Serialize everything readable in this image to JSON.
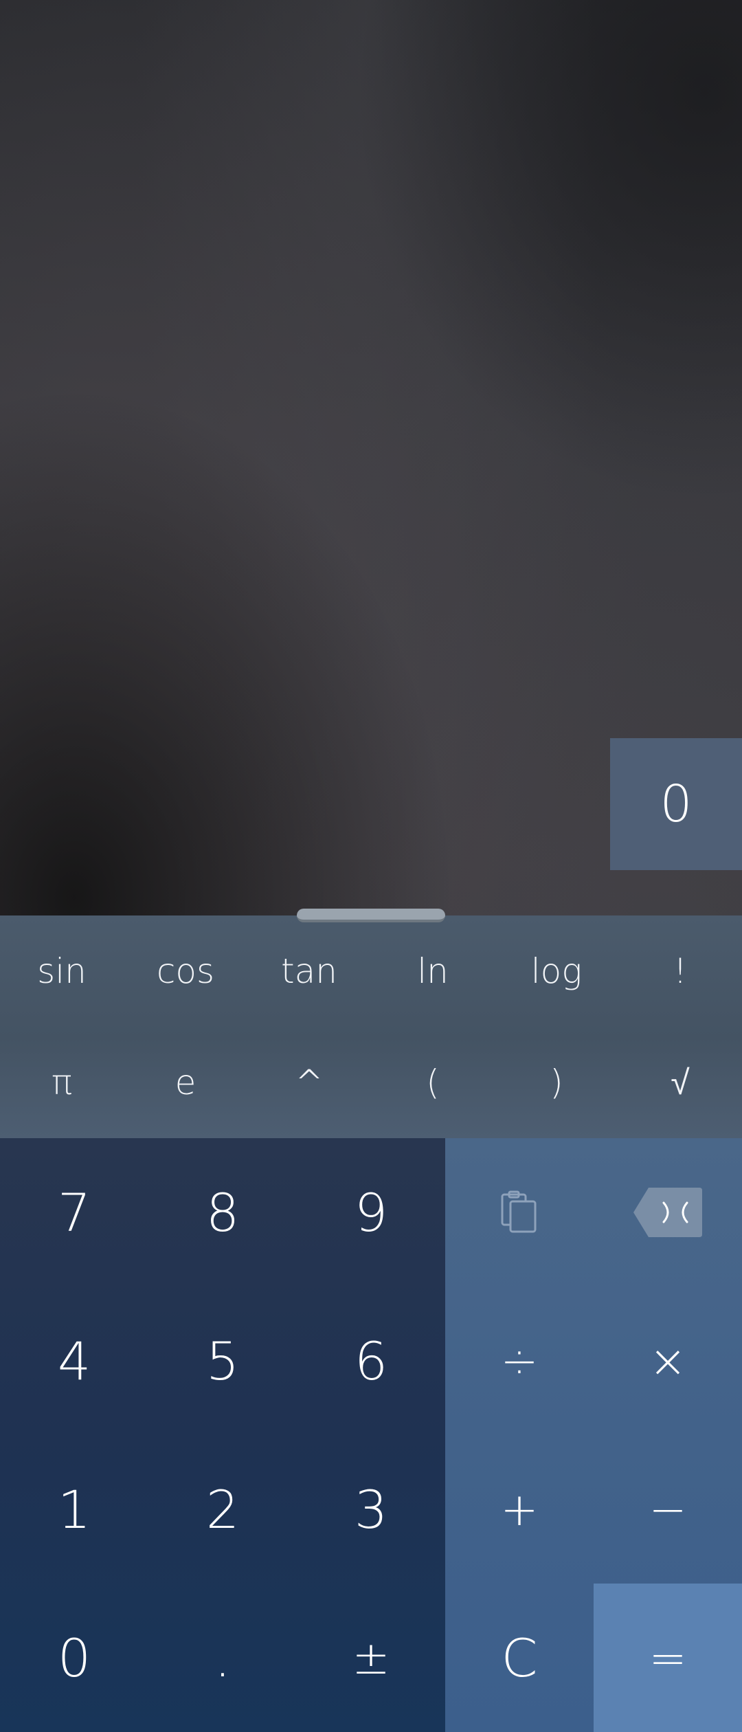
{
  "display": {
    "result": "0"
  },
  "scientific": {
    "row1": [
      "sin",
      "cos",
      "tan",
      "ln",
      "log",
      "!"
    ],
    "row2": [
      "π",
      "e",
      "^",
      "(",
      ")",
      "√"
    ]
  },
  "numpad": {
    "rows": [
      [
        "7",
        "8",
        "9"
      ],
      [
        "4",
        "5",
        "6"
      ],
      [
        "1",
        "2",
        "3"
      ],
      [
        "0",
        ".",
        "±"
      ]
    ]
  },
  "operators": {
    "paste_icon": "clipboard-paste-icon",
    "backspace_icon": "backspace-icon",
    "divide": "÷",
    "multiply": "×",
    "plus": "+",
    "minus": "−",
    "clear": "C",
    "equals": "="
  },
  "colors": {
    "result_bg": "#4f5f76",
    "scientific_bg": "#4b5b6c",
    "numpad_bg": "#1f3252",
    "operator_bg": "#42628a",
    "equals_bg": "#5b82b2"
  }
}
